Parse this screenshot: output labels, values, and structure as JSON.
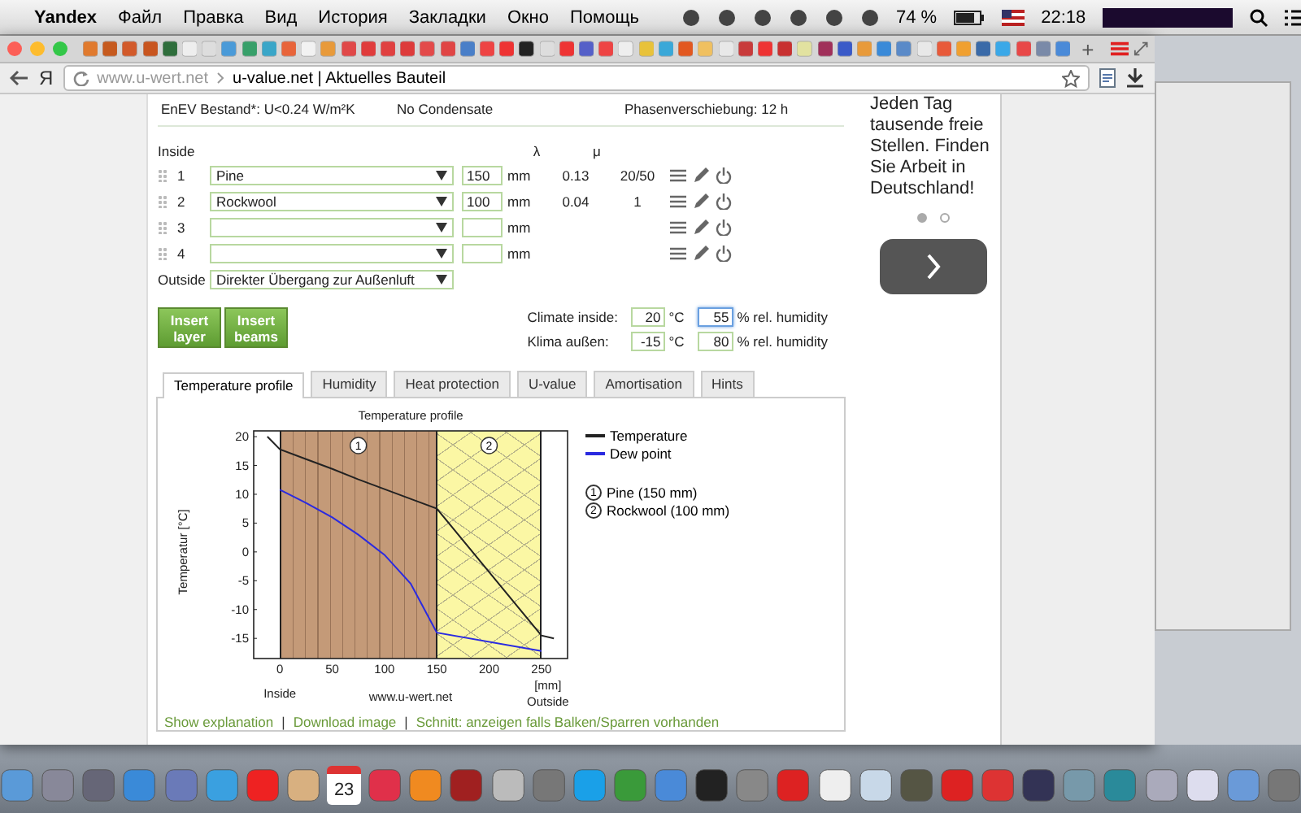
{
  "menubar": {
    "app": "Yandex",
    "menus": [
      "Файл",
      "Правка",
      "Вид",
      "История",
      "Закладки",
      "Окно",
      "Помощь"
    ],
    "battery": "74 %",
    "clock": "22:18"
  },
  "browser": {
    "new_tab": "+",
    "logo": "Я",
    "url_host": "www.u-wert.net",
    "page_title": "u-value.net | Aktuelles Bauteil"
  },
  "summary": [
    "EnEV Bestand*: U<0.24 W/m²K",
    "No Condensate",
    "Phasenverschiebung: 12 h"
  ],
  "layers": {
    "inside_label": "Inside",
    "lambda_header": "λ",
    "mu_header": "μ",
    "rows": [
      {
        "index": "1",
        "material": "Pine",
        "thickness": "150",
        "unit": "mm",
        "lambda": "0.13",
        "mu": "20/50"
      },
      {
        "index": "2",
        "material": "Rockwool",
        "thickness": "100",
        "unit": "mm",
        "lambda": "0.04",
        "mu": "1"
      },
      {
        "index": "3",
        "unit": "mm"
      },
      {
        "index": "4",
        "unit": "mm"
      }
    ],
    "outside_label": "Outside",
    "outside_value": "Direkter Übergang zur Außenluft"
  },
  "buttons": [
    "Insert layer",
    "Insert beams"
  ],
  "climate": [
    {
      "label": "Climate inside:",
      "temperature": "20",
      "temp_unit": "°C",
      "humidity": "55",
      "humidity_unit": "% rel. humidity",
      "focused": true
    },
    {
      "label": "Klima außen:",
      "temperature": "-15",
      "temp_unit": "°C",
      "humidity": "80",
      "humidity_unit": "% rel. humidity",
      "focused": false
    }
  ],
  "tabs": [
    {
      "label": "Temperature profile",
      "selected": true
    },
    {
      "label": "Humidity",
      "selected": false
    },
    {
      "label": "Heat protection",
      "selected": false
    },
    {
      "label": "U-value",
      "selected": false
    },
    {
      "label": "Amortisation",
      "selected": false
    },
    {
      "label": "Hints",
      "selected": false
    }
  ],
  "chart": {
    "chart_data": {
      "type": "line",
      "title": "Temperature profile",
      "xlabel": "[mm]",
      "ylabel": "Temperatur [°C]",
      "x": [
        -12,
        0,
        25,
        50,
        75,
        100,
        125,
        150,
        250,
        262
      ],
      "series": [
        {
          "name": "Temperature",
          "color": "#222222",
          "values": [
            20,
            17.8,
            16.1,
            14.4,
            12.6,
            10.9,
            9.2,
            7.5,
            -14.5,
            -15
          ]
        },
        {
          "name": "Dew point",
          "color": "#2a2ae0",
          "values": [
            null,
            10.8,
            8.5,
            6,
            3,
            -0.5,
            -5.5,
            -14,
            -17.2,
            null
          ]
        }
      ],
      "xlim": [
        -25,
        275
      ],
      "ylim": [
        -18.5,
        21
      ],
      "xticks": [
        0,
        50,
        100,
        150,
        200,
        250
      ],
      "yticks": [
        -15,
        -10,
        -5,
        0,
        5,
        10,
        15,
        20
      ]
    },
    "layers": [
      {
        "marker": "1",
        "number": "1",
        "name": "Pine (150 mm)"
      },
      {
        "marker": "2",
        "number": "2",
        "name": "Rockwool (100 mm)"
      }
    ],
    "inside_label": "Inside",
    "outside_label": "Outside",
    "credit": "www.u-wert.net"
  },
  "links": [
    {
      "kind": "link",
      "text": "Show explanation"
    },
    {
      "kind": "separator",
      "text": "|"
    },
    {
      "kind": "link",
      "text": "Download image"
    },
    {
      "kind": "separator",
      "text": "|"
    },
    {
      "kind": "link",
      "text": "Schnitt: anzeigen falls Balken/Sparren vorhanden"
    }
  ],
  "ad": {
    "text": "Jeden Tag tausende freie Stellen. Finden Sie Arbeit in Deutschland!",
    "dots": [
      {
        "selected": true
      },
      {
        "selected": false
      }
    ]
  },
  "dock": {
    "calendar_day": "23"
  }
}
